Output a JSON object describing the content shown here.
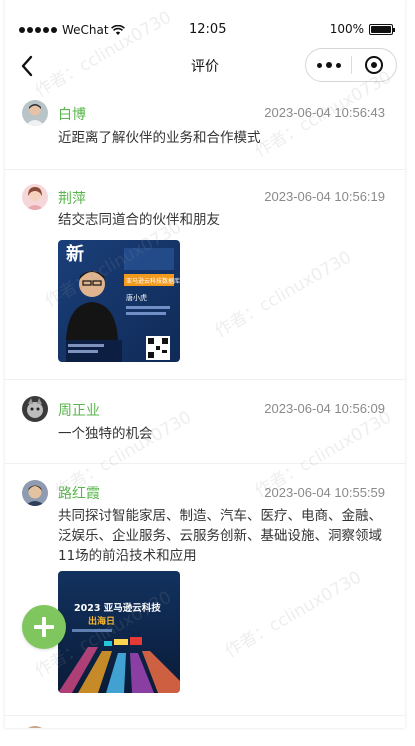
{
  "status_bar": {
    "carrier": "WeChat",
    "time": "12:05",
    "battery": "100%"
  },
  "nav": {
    "title": "评价"
  },
  "comments": [
    {
      "name": "白博",
      "time": "2023-06-04 10:56:43",
      "text": "近距离了解伙伴的业务和合作模式"
    },
    {
      "name": "荆萍",
      "time": "2023-06-04 10:56:19",
      "text": "结交志同道合的伙伴和朋友",
      "image": {
        "headline": "新",
        "banner": "亚马逊云科技数据库",
        "person": "唐小虎"
      }
    },
    {
      "name": "周正业",
      "time": "2023-06-04 10:56:09",
      "text": "一个独特的机会"
    },
    {
      "name": "路红霞",
      "time": "2023-06-04 10:55:59",
      "text": "共同探讨智能家居、制造、汽车、医疗、电商、金融、泛娱乐、企业服务、云服务创新、基础设施、洞察领域11场的前沿技术和应用",
      "image": {
        "headline": "2023 亚马逊云科技",
        "subheadline": "出海日"
      }
    }
  ],
  "watermark": "作者：cclinux0730",
  "colors": {
    "accent_green": "#5bb54e",
    "fab_green": "#7fc65e",
    "time_gray": "#8a8a8a"
  },
  "icons": {
    "back": "chevron-left-icon",
    "more": "more-dots-icon",
    "close": "target-circle-icon",
    "fab": "plus-icon"
  }
}
